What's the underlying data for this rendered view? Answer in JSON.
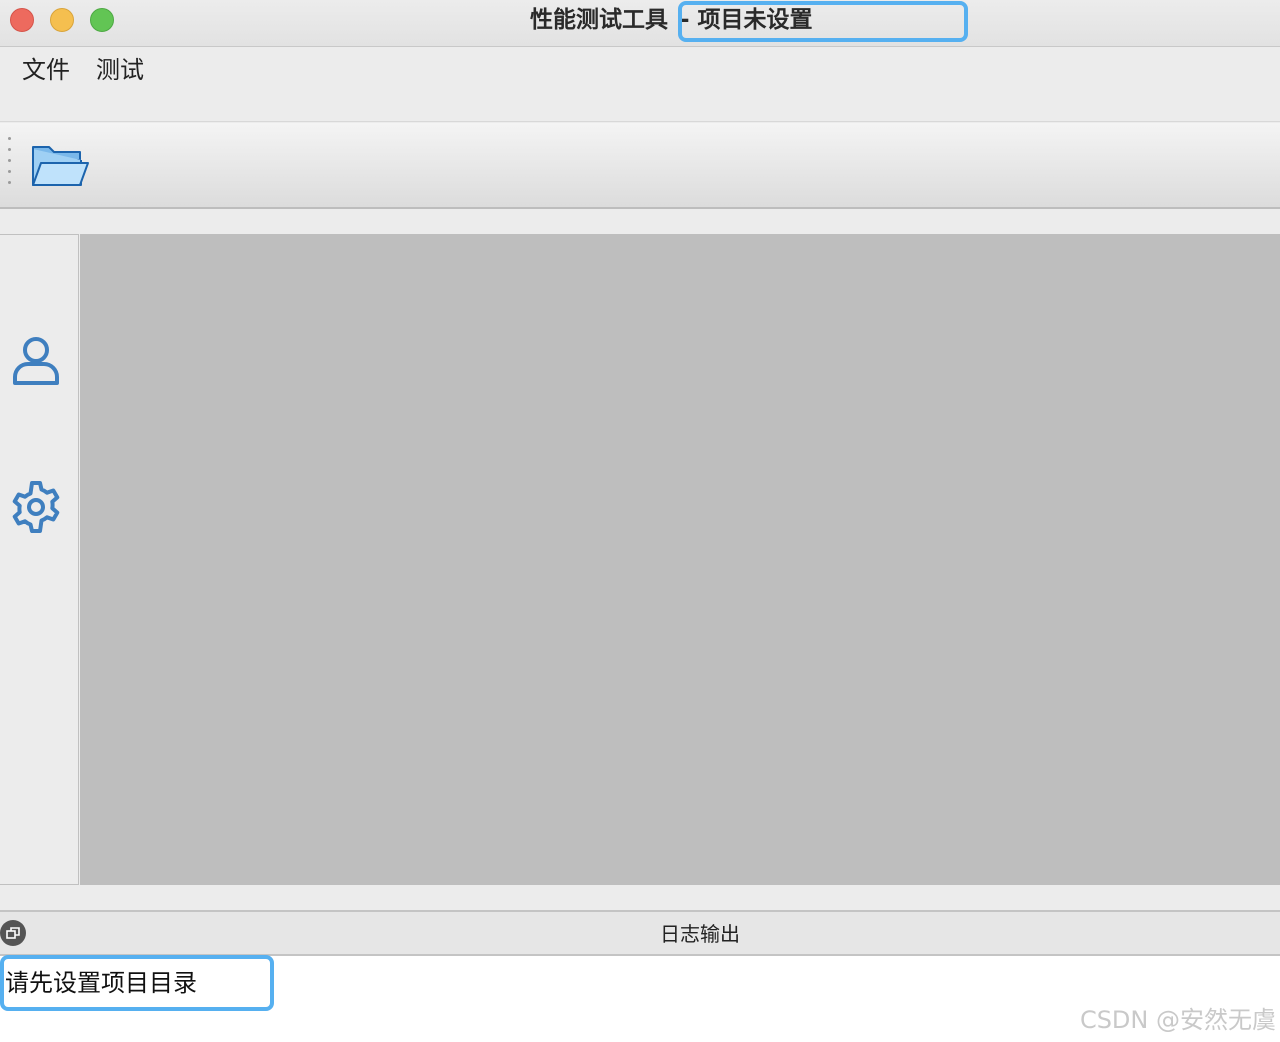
{
  "window": {
    "title": "性能测试工具",
    "title_suffix": "- 项目未设置"
  },
  "menubar": {
    "items": [
      {
        "label": "文件"
      },
      {
        "label": "测试"
      }
    ]
  },
  "toolbar": {
    "open_icon": "folder-open-icon"
  },
  "sidebar": {
    "icons": [
      "user-icon",
      "gear-icon"
    ]
  },
  "dock": {
    "title": "日志输出",
    "float_icon": "restore-window-icon",
    "log_lines": [
      "请先设置项目目录"
    ]
  },
  "watermark": "CSDN @安然无虞",
  "colors": {
    "highlight": "#56b0f0",
    "icon_blue": "#3f7fbf",
    "workspace": "#bebebe"
  }
}
